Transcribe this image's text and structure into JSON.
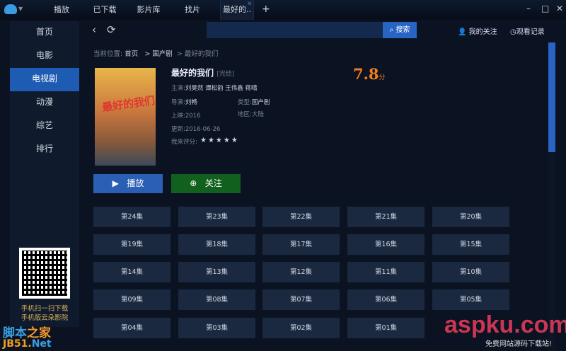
{
  "tabs": [
    "播放",
    "已下载",
    "影片库",
    "找片",
    "最好的.."
  ],
  "sidebar": [
    "首页",
    "电影",
    "电视剧",
    "动漫",
    "综艺",
    "排行"
  ],
  "qr_text": [
    "手机扫一扫下载",
    "手机版云朵影院"
  ],
  "search": {
    "placeholder": "",
    "button": "搜索"
  },
  "toplinks": {
    "follow": "我的关注",
    "history": "观看记录"
  },
  "breadcrumb": {
    "prefix": "当前位置:",
    "home": "首页",
    "cat": "> 国产剧",
    "current": "> 最好的我们"
  },
  "show": {
    "title": "最好的我们",
    "status": "[完结]",
    "score": "7.8",
    "score_unit": "分",
    "cast_label": "主演:",
    "cast": "刘昊然  谭松韵  王伟鑫  蒋晴",
    "director_label": "导演:",
    "director": "刘畅",
    "genre_label": "类型:",
    "genre": "国产剧",
    "year_label": "上映:",
    "year": "2016",
    "region_label": "地区:",
    "region": "大陆",
    "update_label": "更新:",
    "update": "2016-06-26",
    "rating_label": "我来评分:",
    "rating_stars": "★★★★★",
    "poster_text": "最好的我们"
  },
  "actions": {
    "play": "播放",
    "follow": "关注"
  },
  "episodes": [
    "第24集",
    "第23集",
    "第22集",
    "第21集",
    "第20集",
    "第19集",
    "第18集",
    "第17集",
    "第16集",
    "第15集",
    "第14集",
    "第13集",
    "第12集",
    "第11集",
    "第10集",
    "第09集",
    "第08集",
    "第07集",
    "第06集",
    "第05集",
    "第04集",
    "第03集",
    "第02集",
    "第01集"
  ],
  "watermarks": {
    "a": "脚本",
    "b": "之家",
    "c": "JB51.",
    "d": "Net",
    "e": "aspku.com",
    "f": "免费网站源码下载站!"
  }
}
